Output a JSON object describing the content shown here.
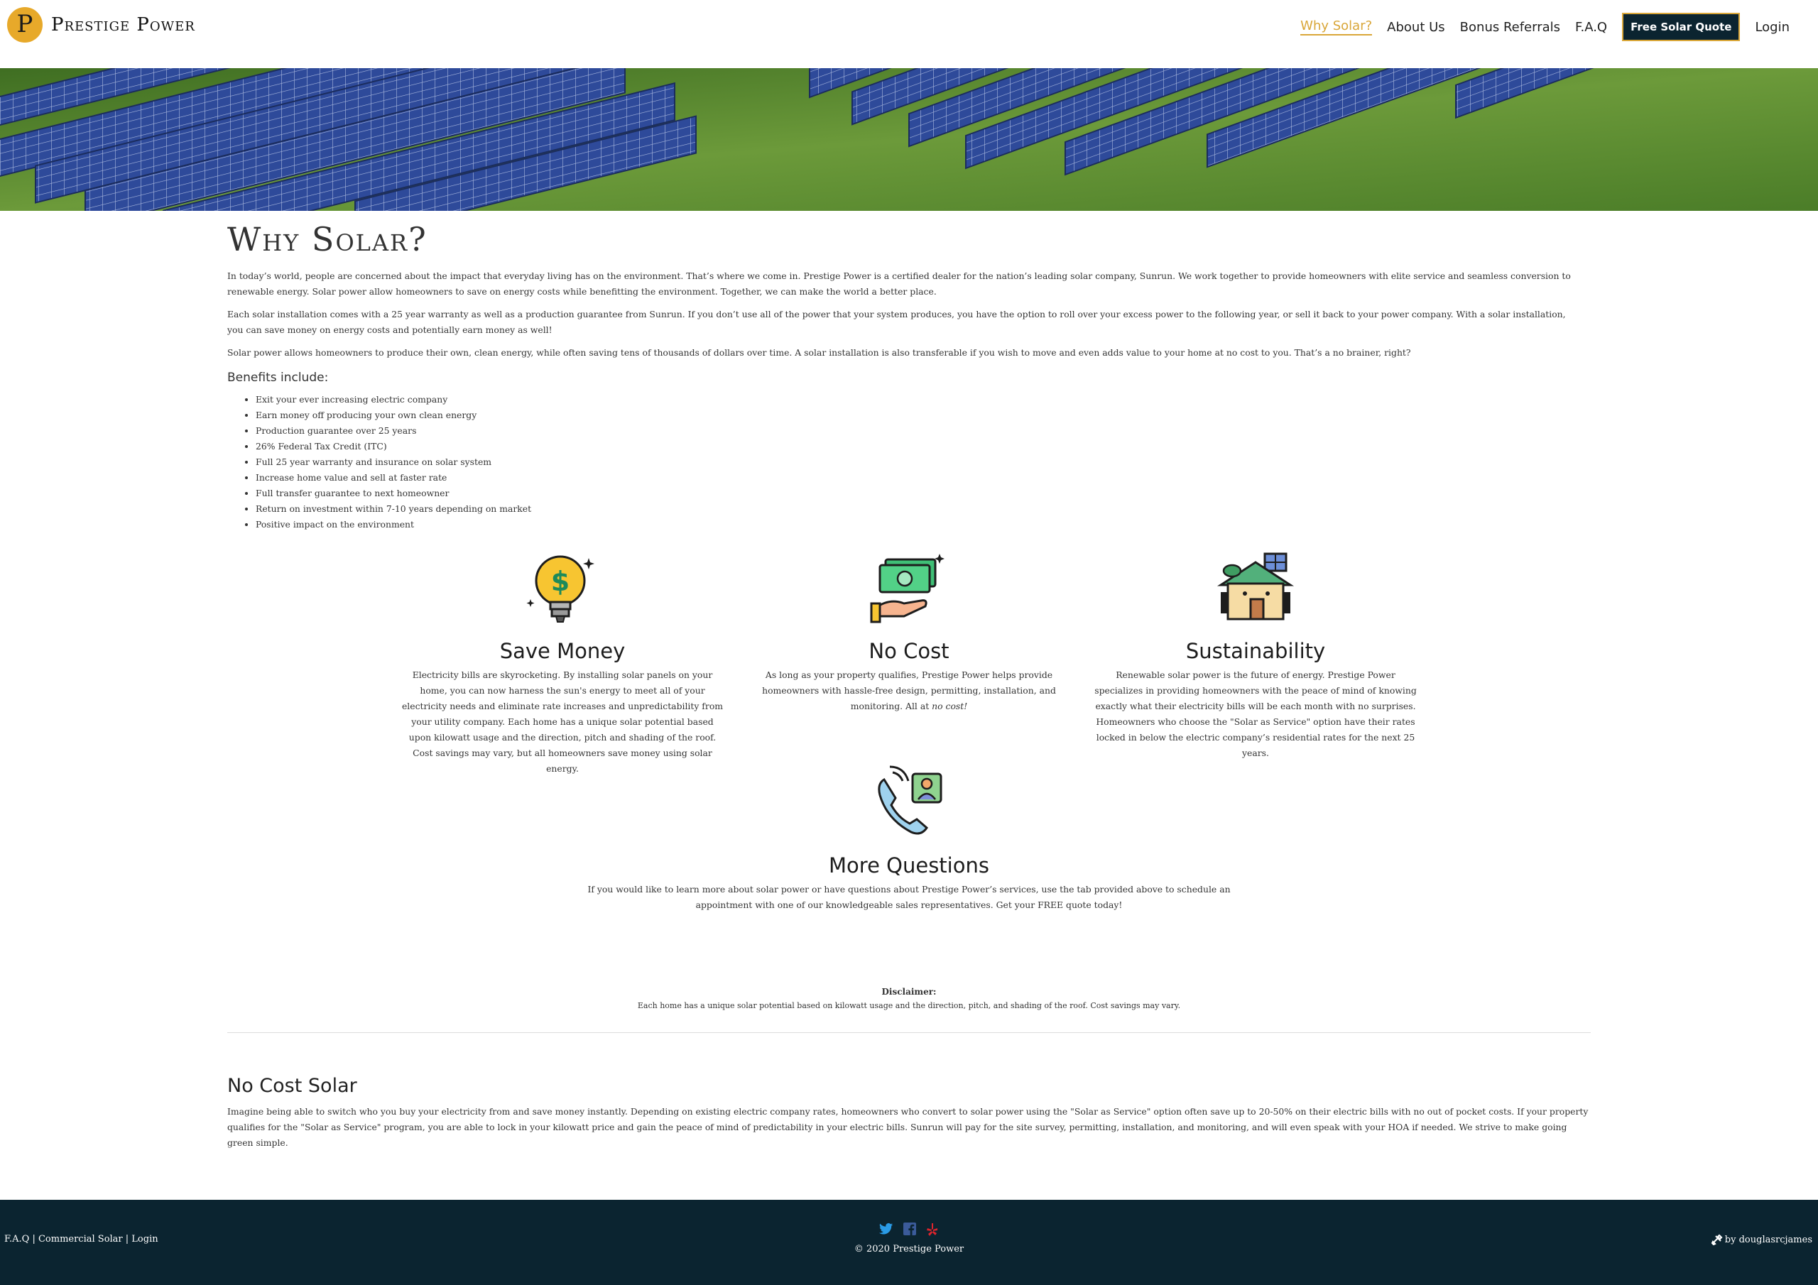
{
  "header": {
    "brand": "Prestige Power",
    "logo_letter": "P",
    "nav": [
      {
        "label": "Why Solar?",
        "active": true
      },
      {
        "label": "About Us"
      },
      {
        "label": "Bonus Referrals"
      },
      {
        "label": "F.A.Q"
      },
      {
        "label": "Free Solar Quote",
        "button": true
      },
      {
        "label": "Login"
      }
    ]
  },
  "main": {
    "title": "Why Solar?",
    "paragraphs": [
      "In today’s world, people are concerned about the impact that everyday living has on the environment. That’s where we come in. Prestige Power is a certified dealer for the nation’s leading solar company, Sunrun. We work together to provide homeowners with elite service and seamless conversion to renewable energy. Solar power allow homeowners to save on energy costs while benefitting the environment. Together, we can make the world a better place.",
      "Each solar installation comes with a 25 year warranty as well as a production guarantee from Sunrun. If you don’t use all of the power that your system produces, you have the option to roll over your excess power to the following year, or sell it back to your power company. With a solar installation, you can save money on energy costs and potentially earn money as well!",
      "Solar power allows homeowners to produce their own, clean energy, while often saving tens of thousands of dollars over time. A solar installation is also transferable if you wish to move and even adds value to your home at no cost to you. That’s a no brainer, right?"
    ],
    "benefits_title": "Benefits include:",
    "benefits": [
      "Exit your ever increasing electric company",
      "Earn money off producing your own clean energy",
      "Production guarantee over 25 years",
      "26% Federal Tax Credit (ITC)",
      "Full 25 year warranty and insurance on solar system",
      "Increase home value and sell at faster rate",
      "Full transfer guarantee to next homeowner",
      "Return on investment within 7-10 years depending on market",
      "Positive impact on the environment"
    ]
  },
  "features": {
    "save": {
      "icon": "lightbulb-dollar-icon",
      "title": "Save Money",
      "text": "Electricity bills are skyrocketing. By installing solar panels on your home, you can now harness the sun's energy to meet all of your electricity needs and eliminate rate increases and unpredictability from your utility company. Each home has a unique solar potential based upon kilowatt usage and the direction, pitch and shading of the roof. Cost savings may vary, but all homeowners save money using solar energy."
    },
    "nocost": {
      "icon": "cash-hand-icon",
      "title": "No Cost",
      "text": "As long as your property qualifies, Prestige Power helps provide homeowners with hassle-free design, permitting, installation, and monitoring. All at ",
      "text_em": "no cost!"
    },
    "sustain": {
      "icon": "solar-house-icon",
      "title": "Sustainability",
      "text": "Renewable solar power is the future of energy. Prestige Power specializes in providing homeowners with the peace of mind of knowing exactly what their electricity bills will be each month with no surprises. Homeowners who choose the \"Solar as Service\" option have their rates locked in below the electric company’s residential rates for the next 25 years."
    },
    "questions": {
      "icon": "phone-contact-icon",
      "title": "More Questions",
      "text": "If you would like to learn more about solar power or have questions about Prestige Power’s services, use the tab provided above to schedule an appointment with one of our knowledgeable sales representatives. Get your FREE quote today!"
    }
  },
  "disclaimer": {
    "label": "Disclaimer:",
    "text": "Each home has a unique solar potential based on kilowatt usage and the direction, pitch, and shading of the roof. Cost savings may vary."
  },
  "nocost_section": {
    "title": "No Cost Solar",
    "text": "Imagine being able to switch who you buy your electricity from and save money instantly. Depending on existing electric company rates, homeowners who convert to solar power using the \"Solar as Service\" option often save up to 20-50% on their electric bills with no out of pocket costs. If your property qualifies for the \"Solar as Service\" program, you are able to lock in your kilowatt price and gain the peace of mind of predictability in your electric bills. Sunrun will pay for the site survey, permitting, installation, and monitoring, and will even speak with your HOA if needed. We strive to make going green simple."
  },
  "footer": {
    "links": [
      "F.A.Q",
      "Commercial Solar",
      "Login"
    ],
    "separator": " | ",
    "copyright": "© 2020 Prestige Power",
    "credit": "by douglasrcjames",
    "bg_color": "#0b2430",
    "social_icons": [
      "twitter-icon",
      "facebook-icon",
      "yelp-icon"
    ]
  },
  "colors": {
    "accent": "#d9a638",
    "footer": "#0b2430"
  }
}
